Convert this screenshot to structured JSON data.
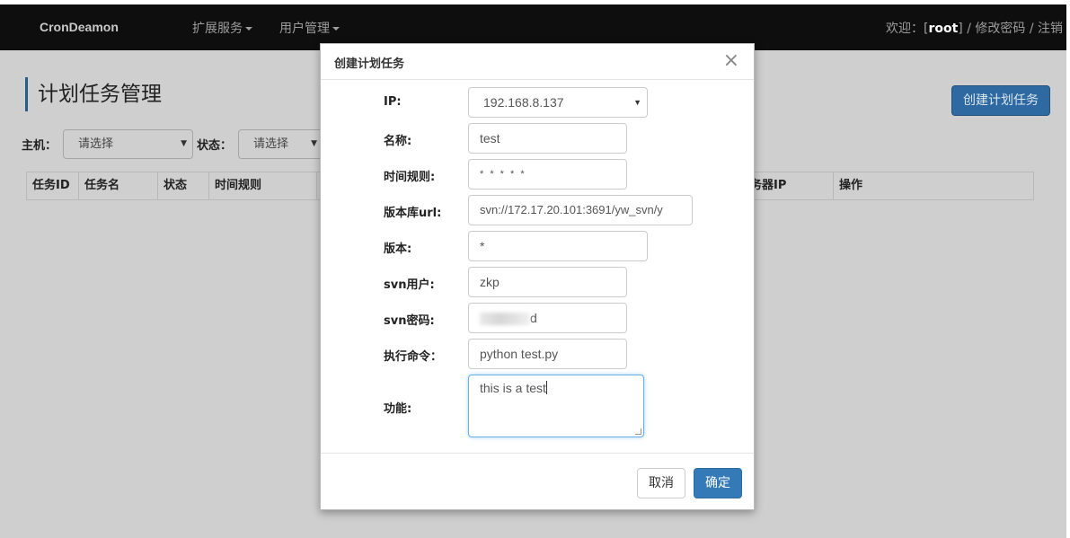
{
  "navbar": {
    "brand": "CronDeamon",
    "menu": [
      "扩展服务",
      "用户管理"
    ],
    "welcome_prefix": "欢迎：[",
    "username": "root",
    "welcome_suffix": "]",
    "sep1": " / ",
    "change_password": "修改密码",
    "sep2": " / ",
    "logout": "注销"
  },
  "page": {
    "title": "计划任务管理",
    "create_button": "创建计划任务",
    "filters": {
      "host_label": "主机：",
      "host_value": "请选择",
      "status_label": "状态：",
      "status_value": "请选择"
    },
    "table_headers": [
      "任务ID",
      "任务名",
      "状态",
      "时间规则",
      "务器IP",
      "操作"
    ]
  },
  "modal": {
    "title": "创建计划任务",
    "close": "×",
    "fields": {
      "ip": {
        "label": "IP:",
        "value": "192.168.8.137"
      },
      "name": {
        "label": "名称:",
        "value": "test"
      },
      "cron": {
        "label": "时间规则:",
        "value": "* * * * *"
      },
      "repo": {
        "label": "版本库url:",
        "value": "svn://172.17.20.101:3691/yw_svn/y"
      },
      "version": {
        "label": "版本:",
        "value": "*"
      },
      "svn_user": {
        "label": "svn用户:",
        "value": "zkp"
      },
      "svn_password": {
        "label": "svn密码:",
        "value": "d"
      },
      "command": {
        "label": "执行命令：",
        "value": "python test.py"
      },
      "function": {
        "label": "功能:",
        "value": "this is a test"
      }
    },
    "cancel": "取消",
    "confirm": "确定"
  },
  "colors": {
    "navbar_bg": "#0e0e0e",
    "primary": "#337ab7",
    "backdrop": "#cfcfcf"
  }
}
